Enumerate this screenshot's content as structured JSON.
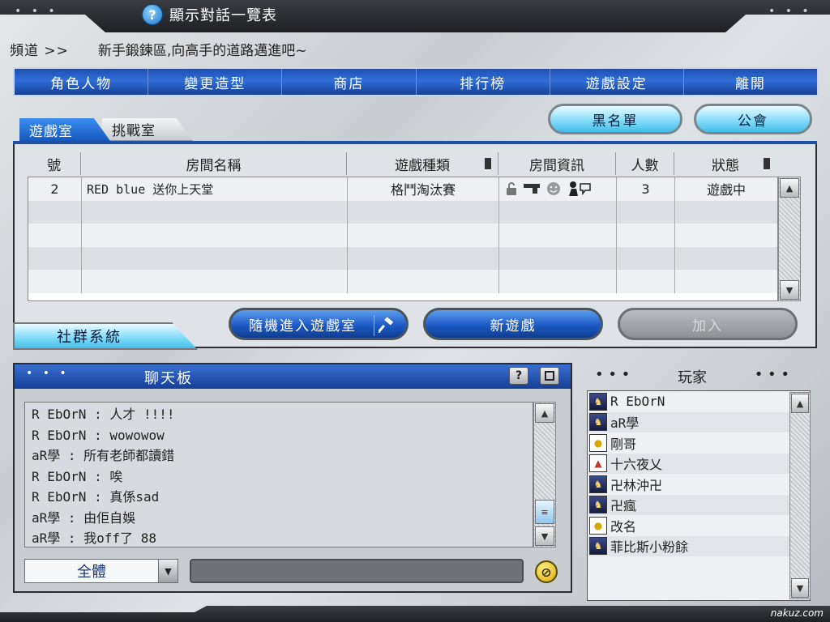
{
  "window": {
    "title": "顯示對話一覽表",
    "help_icon": "?",
    "dots_left": "• • •",
    "dots_right": "• • •"
  },
  "channel": {
    "label": "頻道 >>",
    "message": "新手鍛鍊區,向高手的道路邁進吧~"
  },
  "menu": [
    {
      "label": "角色人物"
    },
    {
      "label": "變更造型"
    },
    {
      "label": "商店"
    },
    {
      "label": "排行榜"
    },
    {
      "label": "遊戲設定"
    },
    {
      "label": "離開"
    }
  ],
  "tabs": {
    "game_room": "遊戲室",
    "challenge_room": "挑戰室"
  },
  "top_buttons": {
    "blacklist": "黑名單",
    "guild": "公會"
  },
  "room_table": {
    "headers": [
      "號",
      "房間名稱",
      "遊戲種類",
      "房間資訊",
      "人數",
      "狀態"
    ],
    "rows": [
      {
        "num": "2",
        "name": "RED blue 送你上天堂",
        "type": "格鬥淘汰賽",
        "count": "3",
        "status": "遊戲中"
      }
    ],
    "empty_rows": 4,
    "info_icons": [
      "lock-open-icon",
      "gun-icon",
      "smile-icon",
      "player-icon"
    ]
  },
  "room_actions": {
    "random_join": "隨機進入遊戲室",
    "new_game": "新遊戲",
    "join": "加入"
  },
  "social_tab": "社群系統",
  "chat": {
    "title": "聊天板",
    "dots": "• • •",
    "help_btn": "?",
    "lines": [
      "R EbOrN : 人才 !!!!",
      "R EbOrN : wowowow",
      "aR學 : 所有老師都讀錯",
      "R EbOrN : 唉",
      "R EbOrN : 真係sad",
      "aR學 : 由佢自娛",
      "aR學 : 我off了 88"
    ],
    "scope": "全體",
    "input_value": ""
  },
  "players": {
    "title": "玩家",
    "dots": "• • •",
    "list": [
      {
        "name": "R EbOrN",
        "avatar": "dark",
        "sword": false
      },
      {
        "name": "aR學",
        "avatar": "dark",
        "sword": false
      },
      {
        "name": "剛哥",
        "avatar": "light",
        "sword": false
      },
      {
        "name": "十六夜乂",
        "avatar": "light",
        "sword": false
      },
      {
        "name": "卍林沖卍",
        "avatar": "dark",
        "sword": true
      },
      {
        "name": "卍瘋",
        "avatar": "dark",
        "sword": true
      },
      {
        "name": "改名",
        "avatar": "light",
        "sword": false
      },
      {
        "name": "菲比斯小粉餘",
        "avatar": "dark",
        "sword": true
      }
    ]
  },
  "watermark": "nakuz.com",
  "colors": {
    "menu_blue": "#1f4fb3",
    "accent_cyan": "#8ee0fb",
    "panel_bg": "#dfe2e6"
  }
}
